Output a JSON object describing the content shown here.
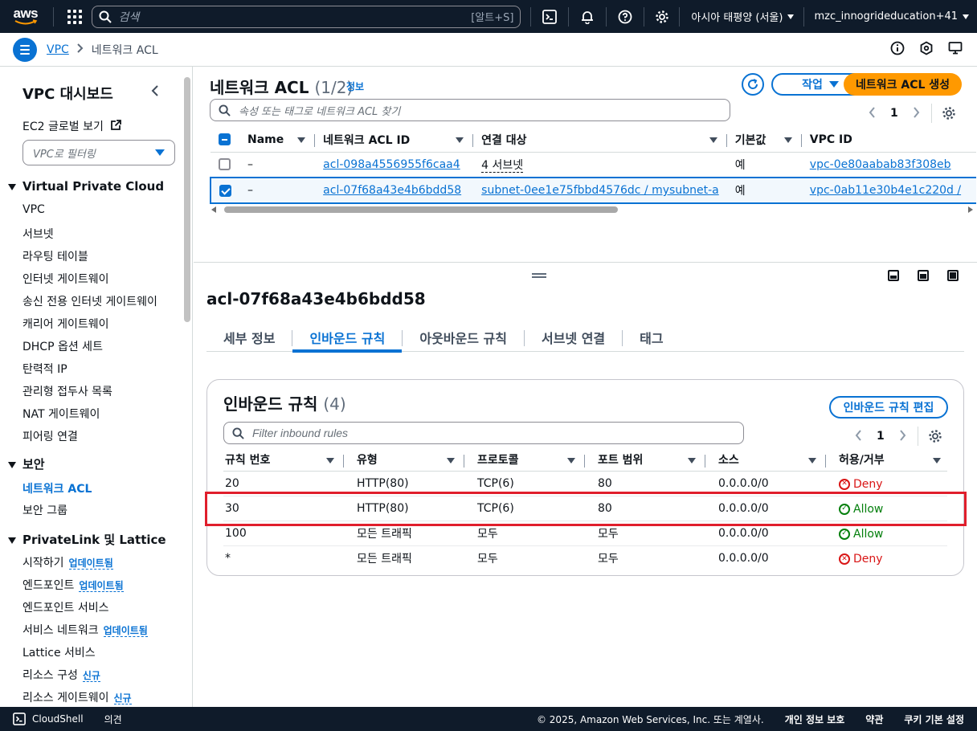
{
  "topnav": {
    "logo": "aws",
    "search_placeholder": "검색",
    "search_shortcut": "[알트+S]",
    "region": "아시아 태평양 (서울)",
    "account": "mzc_innogrideducation+41",
    "icons": [
      "apps-grid-icon",
      "cloudshell-icon",
      "bell-icon",
      "help-icon",
      "gear-icon"
    ]
  },
  "breadcrumb": {
    "root": "VPC",
    "current": "네트워크 ACL"
  },
  "sidebar": {
    "title": "VPC 대시보드",
    "ec2_global": "EC2 글로벌 보기",
    "filter_placeholder": "VPC로 필터링",
    "section_vpc": "Virtual Private Cloud",
    "vpc_items": [
      "VPC",
      "서브넷",
      "라우팅 테이블",
      "인터넷 게이트웨이",
      "송신 전용 인터넷 게이트웨이",
      "캐리어 게이트웨이",
      "DHCP 옵션 세트",
      "탄력적 IP",
      "관리형 접두사 목록",
      "NAT 게이트웨이",
      "피어링 연결"
    ],
    "section_security": "보안",
    "security_items": [
      "네트워크 ACL",
      "보안 그룹"
    ],
    "section_privatelink": "PrivateLink 및 Lattice",
    "privatelink_items": [
      {
        "label": "시작하기",
        "badge": "업데이트됨"
      },
      {
        "label": "엔드포인트",
        "badge": "업데이트됨"
      },
      {
        "label": "엔드포인트 서비스",
        "badge": ""
      },
      {
        "label": "서비스 네트워크",
        "badge": "업데이트됨"
      },
      {
        "label": "Lattice 서비스",
        "badge": ""
      },
      {
        "label": "리소스 구성",
        "badge": "신규"
      },
      {
        "label": "리소스 게이트웨이",
        "badge": "신규"
      }
    ]
  },
  "acl_list": {
    "title": "네트워크 ACL",
    "count": "(1/2)",
    "info": "정보",
    "action_button": "작업",
    "create_button": "네트워크 ACL 생성",
    "filter_placeholder": "속성 또는 태그로 네트워크 ACL 찾기",
    "page": "1",
    "columns": [
      "Name",
      "네트워크 ACL ID",
      "연결 대상",
      "기본값",
      "VPC ID"
    ],
    "rows": [
      {
        "name": "–",
        "id": "acl-098a4556955f6caa4",
        "assoc": "4 서브넷",
        "default": "예",
        "vpc": "vpc-0e80aabab83f308eb",
        "selected": false
      },
      {
        "name": "–",
        "id": "acl-07f68a43e4b6bdd58",
        "assoc": "subnet-0ee1e75fbbd4576dc / mysubnet-a",
        "default": "예",
        "vpc": "vpc-0ab11e30b4e1c220d /",
        "selected": true
      }
    ]
  },
  "detail": {
    "title": "acl-07f68a43e4b6bdd58",
    "tabs": [
      "세부 정보",
      "인바운드 규칙",
      "아웃바운드 규칙",
      "서브넷 연결",
      "태그"
    ],
    "active_tab": "인바운드 규칙"
  },
  "inbound": {
    "title": "인바운드 규칙",
    "count": "(4)",
    "edit_button": "인바운드 규칙 편집",
    "filter_placeholder": "Filter inbound rules",
    "page": "1",
    "columns": [
      "규칙 번호",
      "유형",
      "프로토콜",
      "포트 범위",
      "소스",
      "허용/거부"
    ],
    "rows": [
      {
        "rule": "20",
        "type": "HTTP(80)",
        "protocol": "TCP(6)",
        "port": "80",
        "source": "0.0.0.0/0",
        "action": "Deny"
      },
      {
        "rule": "30",
        "type": "HTTP(80)",
        "protocol": "TCP(6)",
        "port": "80",
        "source": "0.0.0.0/0",
        "action": "Allow"
      },
      {
        "rule": "100",
        "type": "모든 트래픽",
        "protocol": "모두",
        "port": "모두",
        "source": "0.0.0.0/0",
        "action": "Allow"
      },
      {
        "rule": "*",
        "type": "모든 트래픽",
        "protocol": "모두",
        "port": "모두",
        "source": "0.0.0.0/0",
        "action": "Deny"
      }
    ]
  },
  "footer": {
    "cloudshell": "CloudShell",
    "feedback": "의견",
    "copyright": "© 2025, Amazon Web Services, Inc. 또는 계열사.",
    "privacy": "개인 정보 보호",
    "terms": "약관",
    "cookies": "쿠키 기본 설정"
  },
  "colors": {
    "nav_bg": "#0f1b2a",
    "link": "#0972d3",
    "primary": "#ff9900",
    "deny": "#d91515",
    "allow": "#037f0c",
    "highlight": "#e01e2c"
  }
}
